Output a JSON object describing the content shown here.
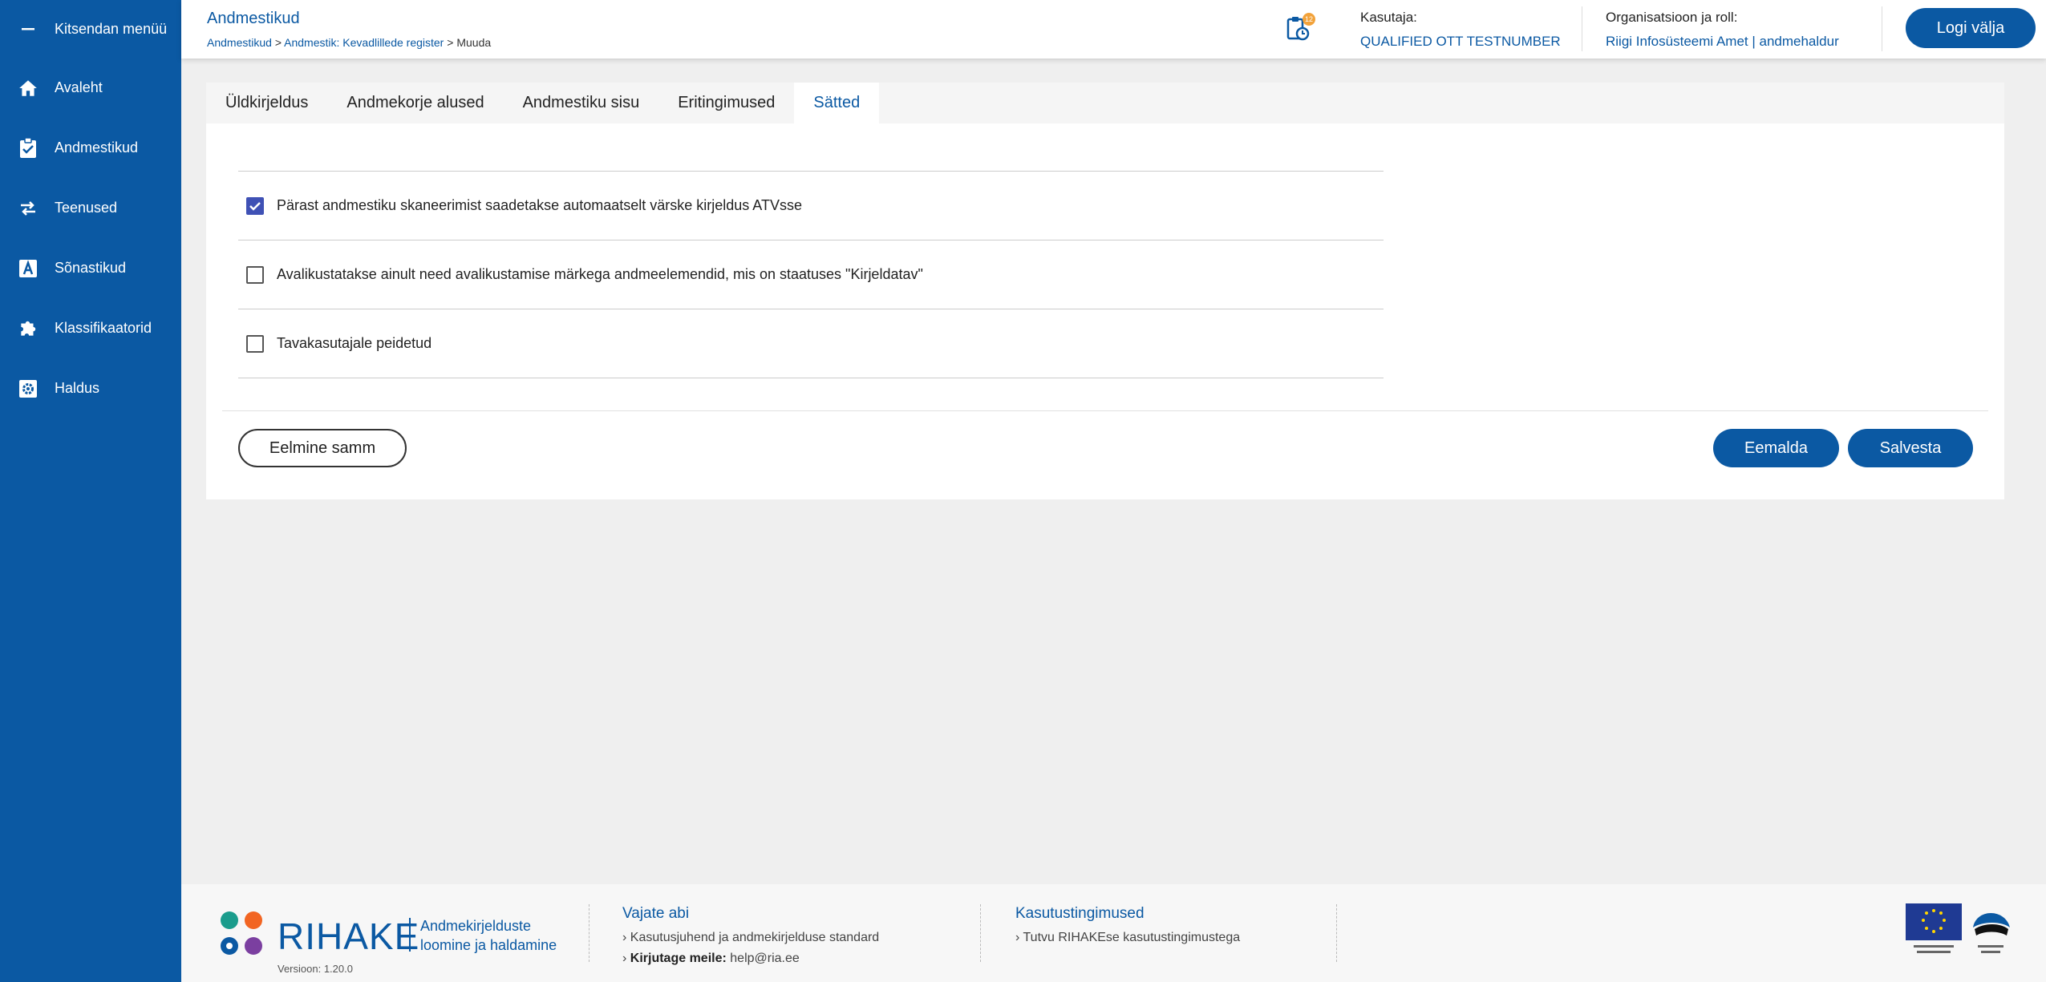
{
  "sidebar": {
    "collapse_label": "Kitsendan menüü",
    "items": [
      {
        "label": "Avaleht",
        "icon": "home-icon"
      },
      {
        "label": "Andmestikud",
        "icon": "clipboard-check-icon"
      },
      {
        "label": "Teenused",
        "icon": "swap-arrows-icon"
      },
      {
        "label": "Sõnastikud",
        "icon": "dictionary-a-icon"
      },
      {
        "label": "Klassifikaatorid",
        "icon": "puzzle-icon"
      },
      {
        "label": "Haldus",
        "icon": "gear-box-icon"
      }
    ]
  },
  "header": {
    "title": "Andmestikud",
    "breadcrumb": [
      "Andmestikud",
      "Andmestik: Kevadlillede register",
      "Muuda"
    ],
    "breadcrumb_sep": ">",
    "notification_count": "12",
    "user_label": "Kasutaja:",
    "user_value": "QUALIFIED OTT TESTNUMBER",
    "org_label": "Organisatsioon ja roll:",
    "org_value": "Riigi Infosüsteemi Amet | andmehaldur",
    "logout_label": "Logi välja"
  },
  "tabs": [
    {
      "label": "Üldkirjeldus",
      "active": false
    },
    {
      "label": "Andmekorje alused",
      "active": false
    },
    {
      "label": "Andmestiku sisu",
      "active": false
    },
    {
      "label": "Eritingimused",
      "active": false
    },
    {
      "label": "Sätted",
      "active": true
    }
  ],
  "settings": [
    {
      "label": "Pärast andmestiku skaneerimist saadetakse automaatselt värske kirjeldus ATVsse",
      "checked": true
    },
    {
      "label": "Avalikustatakse ainult need avalikustamise märkega andmeelemendid, mis on staatuses \"Kirjeldatav\"",
      "checked": false
    },
    {
      "label": "Tavakasutajale peidetud",
      "checked": false
    }
  ],
  "actions": {
    "prev_label": "Eelmine samm",
    "remove_label": "Eemalda",
    "save_label": "Salvesta"
  },
  "footer": {
    "brand": "RIHAKE",
    "tagline_1": "Andmekirjelduste",
    "tagline_2": "loomine ja haldamine",
    "version": "Versioon: 1.20.0",
    "help_title": "Vajate abi",
    "help_link": "Kasutusjuhend ja andmekirjelduse standard",
    "mail_label": "Kirjutage meile:",
    "mail_value": "help@ria.ee",
    "terms_title": "Kasutustingimused",
    "terms_link": "Tutvu RIHAKEse kasutustingimustega",
    "colors": {
      "brand": "#0b59a3",
      "dot1": "#1a9c8c",
      "dot2": "#f26522",
      "dot3": "#0b59a3",
      "dot4": "#7b3fa0"
    }
  }
}
